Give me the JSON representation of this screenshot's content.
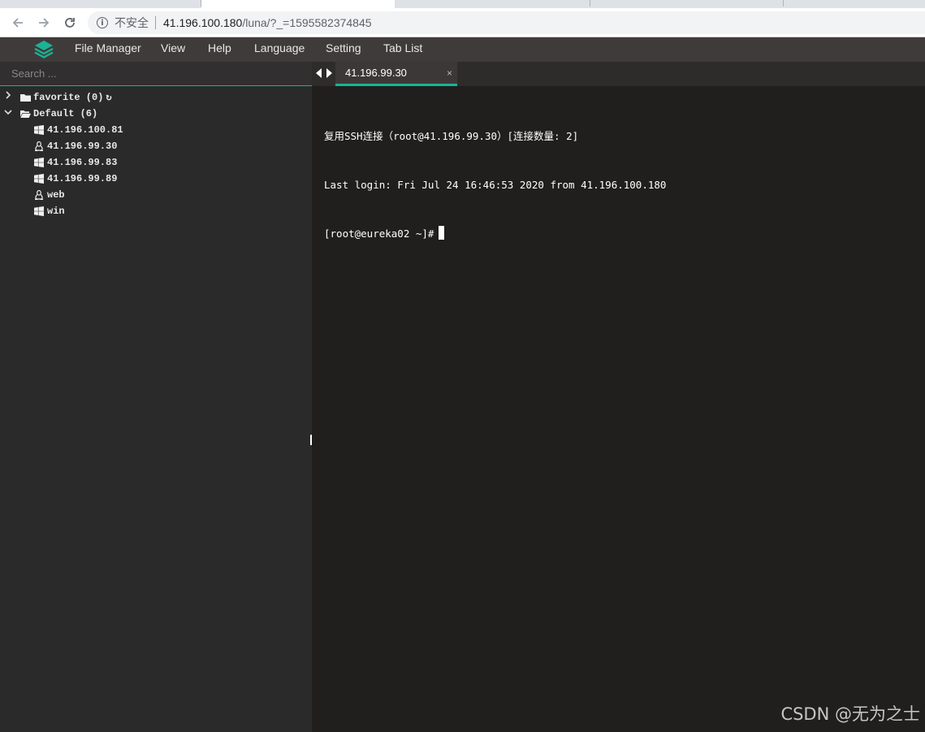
{
  "browser": {
    "security_label": "不安全",
    "url_host": "41.196.100.180",
    "url_path": "/luna/?_=1595582374845"
  },
  "menu": {
    "items": [
      "File Manager",
      "View",
      "Help",
      "Language",
      "Setting",
      "Tab List"
    ]
  },
  "sidebar": {
    "search_placeholder": "Search ...",
    "groups": [
      {
        "label": "favorite (0)",
        "expanded": false
      },
      {
        "label": "Default (6)",
        "expanded": true
      }
    ],
    "hosts": [
      {
        "label": "41.196.100.81",
        "icon": "windows-icon"
      },
      {
        "label": "41.196.99.30",
        "icon": "linux-icon"
      },
      {
        "label": "41.196.99.83",
        "icon": "windows-icon"
      },
      {
        "label": "41.196.99.89",
        "icon": "windows-icon"
      },
      {
        "label": "web",
        "icon": "linux-icon"
      },
      {
        "label": "win",
        "icon": "windows-icon"
      }
    ]
  },
  "terminal": {
    "tab_label": "41.196.99.30",
    "tab_close": "×",
    "lines": [
      "复用SSH连接（root@41.196.99.30）[连接数量: 2]",
      "Last login: Fri Jul 24 16:46:53 2020 from 41.196.100.180",
      "[root@eureka02 ~]#"
    ]
  },
  "watermark": "CSDN @无为之士",
  "colors": {
    "accent": "#1ab394",
    "menubar": "#403b3b",
    "sidebar": "#2b2a2a",
    "terminal_bg": "#211e1e"
  }
}
